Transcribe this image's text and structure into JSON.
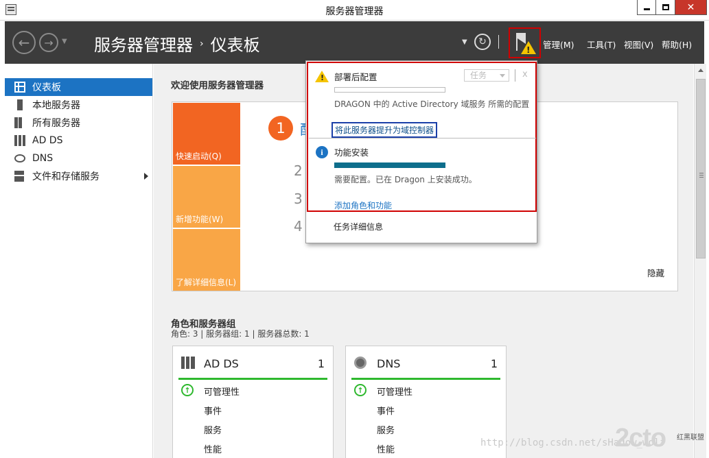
{
  "window": {
    "title": "服务器管理器"
  },
  "header": {
    "breadcrumb_root": "服务器管理器",
    "breadcrumb_sep": "›",
    "breadcrumb_current": "仪表板",
    "menus": [
      "管理(M)",
      "工具(T)",
      "视图(V)",
      "帮助(H)"
    ]
  },
  "sidebar": {
    "items": [
      {
        "label": "仪表板",
        "active": true
      },
      {
        "label": "本地服务器"
      },
      {
        "label": "所有服务器"
      },
      {
        "label": "AD DS"
      },
      {
        "label": "DNS"
      },
      {
        "label": "文件和存储服务"
      }
    ]
  },
  "welcome": {
    "title": "欢迎使用服务器管理器",
    "tiles": [
      "快速启动(Q)",
      "新增功能(W)",
      "了解详细信息(L)"
    ],
    "step1": "1",
    "step1_peek": "配",
    "steps_hidden": [
      "2",
      "3",
      "4"
    ],
    "hide": "隐藏"
  },
  "roles": {
    "title": "角色和服务器组",
    "subtitle": "角色: 3 | 服务器组: 1 | 服务器总数: 1",
    "cards": [
      {
        "name": "AD DS",
        "count": "1",
        "rows": [
          "可管理性",
          "事件",
          "服务",
          "性能"
        ]
      },
      {
        "name": "DNS",
        "count": "1",
        "rows": [
          "可管理性",
          "事件",
          "服务",
          "性能"
        ]
      }
    ]
  },
  "notifications": {
    "post_deploy": {
      "title": "部署后配置",
      "task_button": "任务",
      "close": "x",
      "description": "DRAGON 中的 Active Directory 域服务 所需的配置",
      "link": "将此服务器提升为域控制器"
    },
    "feature_install": {
      "title": "功能安装",
      "progress": 1.0,
      "description": "需要配置。已在 Dragon 上安装成功。",
      "link": "添加角色和功能"
    },
    "task_details": "任务详细信息"
  },
  "watermark": {
    "url": "http://blog.csdn.net/sHadow_wolf",
    "logo": "2cto",
    "logo_sub": "红黑联盟"
  },
  "colors": {
    "accent": "#1c73c3",
    "quick_start": "#f26522",
    "tile": "#f9a646",
    "alert": "#d00000",
    "ok": "#2eb82e"
  }
}
